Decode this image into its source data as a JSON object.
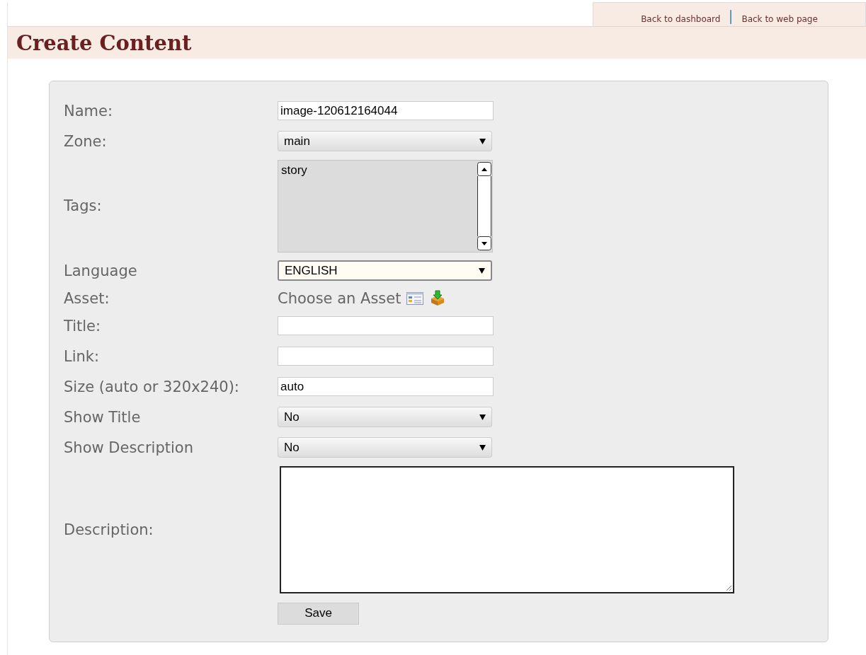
{
  "top_links": [
    {
      "label": "Back to dashboard"
    },
    {
      "label": "Back to web page"
    }
  ],
  "page_title": "Create Content",
  "form": {
    "fields": [
      {
        "kind": "text",
        "label": "Name:",
        "value": "image-120612164044"
      },
      {
        "kind": "select",
        "label": "Zone:",
        "value": "main",
        "focused": false
      },
      {
        "kind": "listbox",
        "label": "Tags:",
        "options": [
          "story"
        ]
      },
      {
        "kind": "select",
        "label": "Language",
        "value": "ENGLISH",
        "focused": true
      },
      {
        "kind": "asset",
        "label": "Asset:",
        "value": "Choose an Asset"
      },
      {
        "kind": "text",
        "label": "Title:"
      },
      {
        "kind": "text",
        "label": "Link:"
      },
      {
        "kind": "text",
        "label": "Size (auto or 320x240):",
        "value": "auto"
      },
      {
        "kind": "select",
        "label": "Show Title",
        "value": "No",
        "focused": false
      },
      {
        "kind": "select",
        "label": "Show Description",
        "value": "No",
        "focused": false
      },
      {
        "kind": "textarea",
        "label": "Description:"
      }
    ],
    "save_button": "Save"
  }
}
